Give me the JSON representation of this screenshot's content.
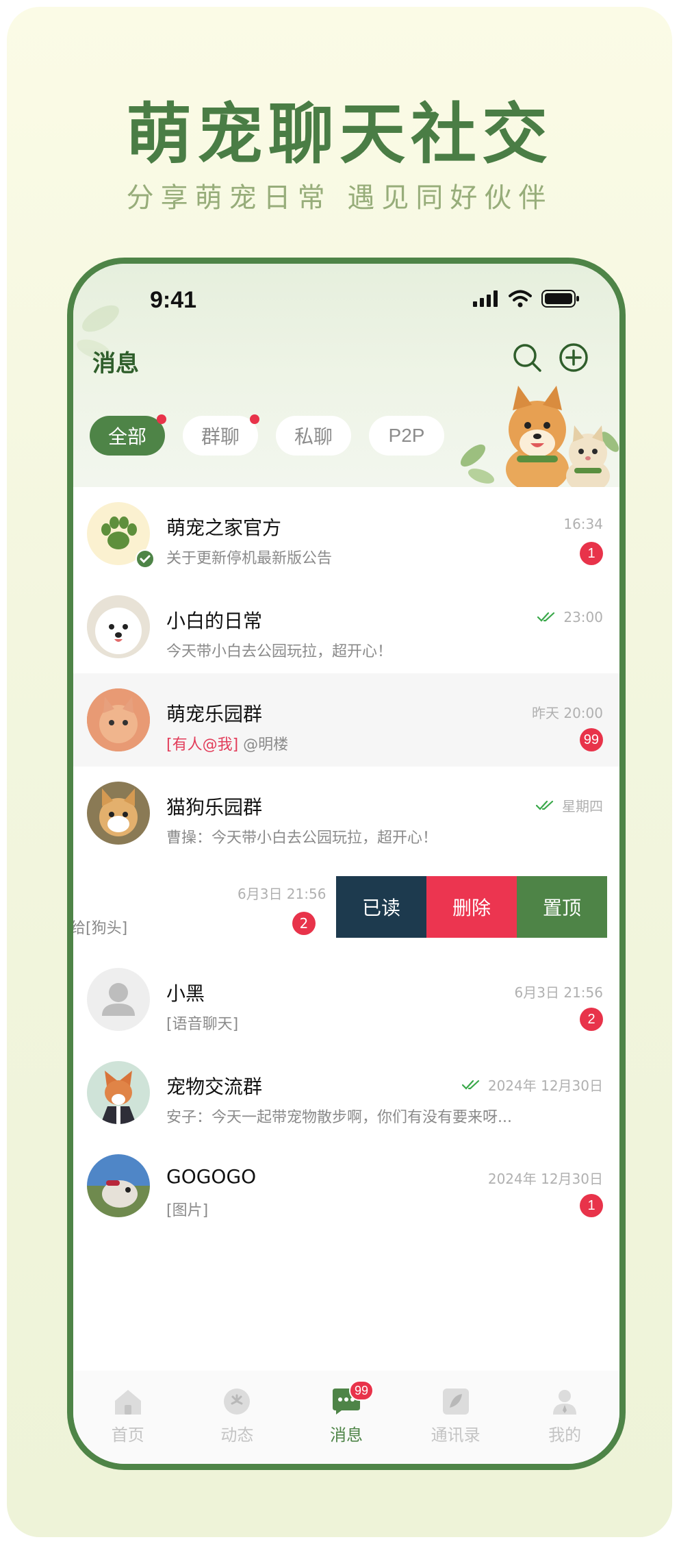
{
  "promo": {
    "headline": "萌宠聊天社交",
    "subline": "分享萌宠日常 遇见同好伙伴"
  },
  "status_bar": {
    "time": "9:41"
  },
  "header": {
    "title": "消息",
    "search_icon": "search-icon",
    "add_icon": "plus-circle-icon"
  },
  "tabs": [
    {
      "label": "全部",
      "active": true,
      "dot": true
    },
    {
      "label": "群聊",
      "active": false,
      "dot": true
    },
    {
      "label": "私聊",
      "active": false,
      "dot": false
    },
    {
      "label": "P2P",
      "active": false,
      "dot": false
    }
  ],
  "conversations": [
    {
      "name": "萌宠之家官方",
      "message": "关于更新停机最新版公告",
      "time": "16:34",
      "badge": "1",
      "read_check": false
    },
    {
      "name": "小白的日常",
      "message": "今天带小白去公园玩拉，超开心！",
      "time": "23:00",
      "badge": "",
      "read_check": true
    },
    {
      "name": "萌宠乐园群",
      "mention": "[有人@我]",
      "message": " @明楼",
      "time": "昨天 20:00",
      "badge": "99",
      "read_check": false
    },
    {
      "name": "猫狗乐园群",
      "message": "曹操：今天带小白去公园玩拉，超开心！",
      "time": "星期四",
      "badge": "",
      "read_check": true
    },
    {
      "name": "",
      "message": "给[狗头]",
      "time": "6月3日 21:56",
      "badge": "2",
      "swiped": true
    },
    {
      "name": "小黑",
      "message": "[语音聊天]",
      "time": "6月3日 21:56",
      "badge": "2",
      "read_check": false
    },
    {
      "name": "宠物交流群",
      "message": "安子：今天一起带宠物散步啊，你们有没有要来呀...",
      "time": "2024年 12月30日",
      "badge": "",
      "read_check": true
    },
    {
      "name": "GOGOGO",
      "message": "[图片]",
      "time": "2024年 12月30日",
      "badge": "1",
      "read_check": false
    }
  ],
  "swipe_actions": {
    "read": "已读",
    "delete": "删除",
    "pin": "置顶"
  },
  "tabbar": [
    {
      "label": "首页",
      "icon": "home-icon"
    },
    {
      "label": "动态",
      "icon": "feed-icon"
    },
    {
      "label": "消息",
      "icon": "chat-icon",
      "active": true,
      "badge": "99"
    },
    {
      "label": "通讯录",
      "icon": "contacts-icon"
    },
    {
      "label": "我的",
      "icon": "profile-icon"
    }
  ],
  "colors": {
    "brand": "#4e8447",
    "badge": "#e8334a",
    "mention": "#e23d5a",
    "read_action": "#1d3a4e",
    "delete_action": "#ec3550"
  }
}
